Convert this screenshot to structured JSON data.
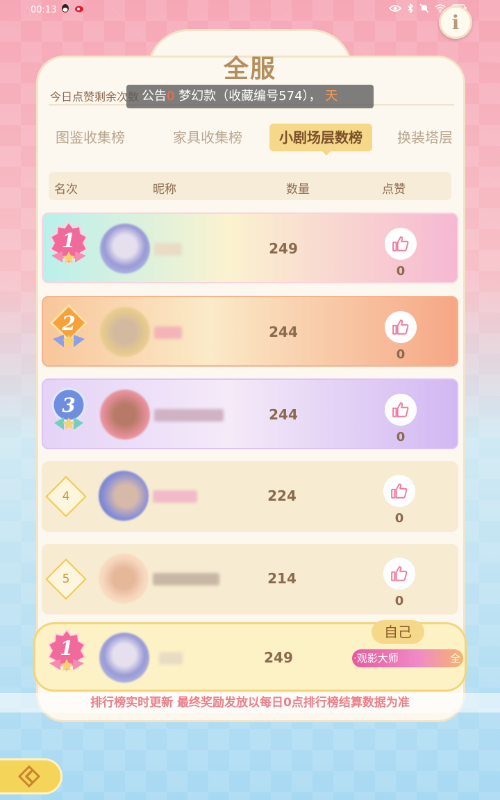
{
  "status_bar": {
    "time": "00:13",
    "left_icons": [
      "qq-icon",
      "weibo-icon"
    ],
    "right_icons": [
      "eye-icon",
      "bluetooth-icon",
      "mute-icon",
      "wifi-icon",
      "battery-icon"
    ]
  },
  "info_button": {
    "label": "i"
  },
  "panel": {
    "title": "全服",
    "like_remaining": "今日点赞剩余次数",
    "notice": {
      "prefix": "公告",
      "zero": "0",
      "text": "梦幻款（收藏编号574）",
      "comma": "，",
      "highlight": "天"
    }
  },
  "tabs": [
    {
      "label": "图鉴收集榜",
      "active": false
    },
    {
      "label": "家具收集榜",
      "active": false
    },
    {
      "label": "小剧场层数榜",
      "active": true
    },
    {
      "label": "换装塔层",
      "active": false
    }
  ],
  "table_header": {
    "rank": "名次",
    "nickname": "昵称",
    "count": "数量",
    "likes": "点赞"
  },
  "rows": [
    {
      "rank": "1",
      "count": "249",
      "likes": "0"
    },
    {
      "rank": "2",
      "count": "244",
      "likes": "0"
    },
    {
      "rank": "3",
      "count": "244",
      "likes": "0"
    },
    {
      "rank": "4",
      "count": "224",
      "likes": "0"
    },
    {
      "rank": "5",
      "count": "214",
      "likes": "0"
    }
  ],
  "self_row": {
    "rank": "1",
    "count": "249",
    "tag": "自己",
    "title_left": "·观影大师",
    "title_right": "全"
  },
  "footer_note": "排行榜实时更新 最终奖励发放以每日0点排行榜结算数据为准",
  "colors": {
    "accent_gold": "#f5d88a",
    "title_brown": "#b48e5c",
    "footer_pink": "#ec7f8a",
    "rank1_pink": "#f06b9b",
    "rank2_orange": "#f6a13a",
    "rank3_blue": "#6f8ee0"
  }
}
